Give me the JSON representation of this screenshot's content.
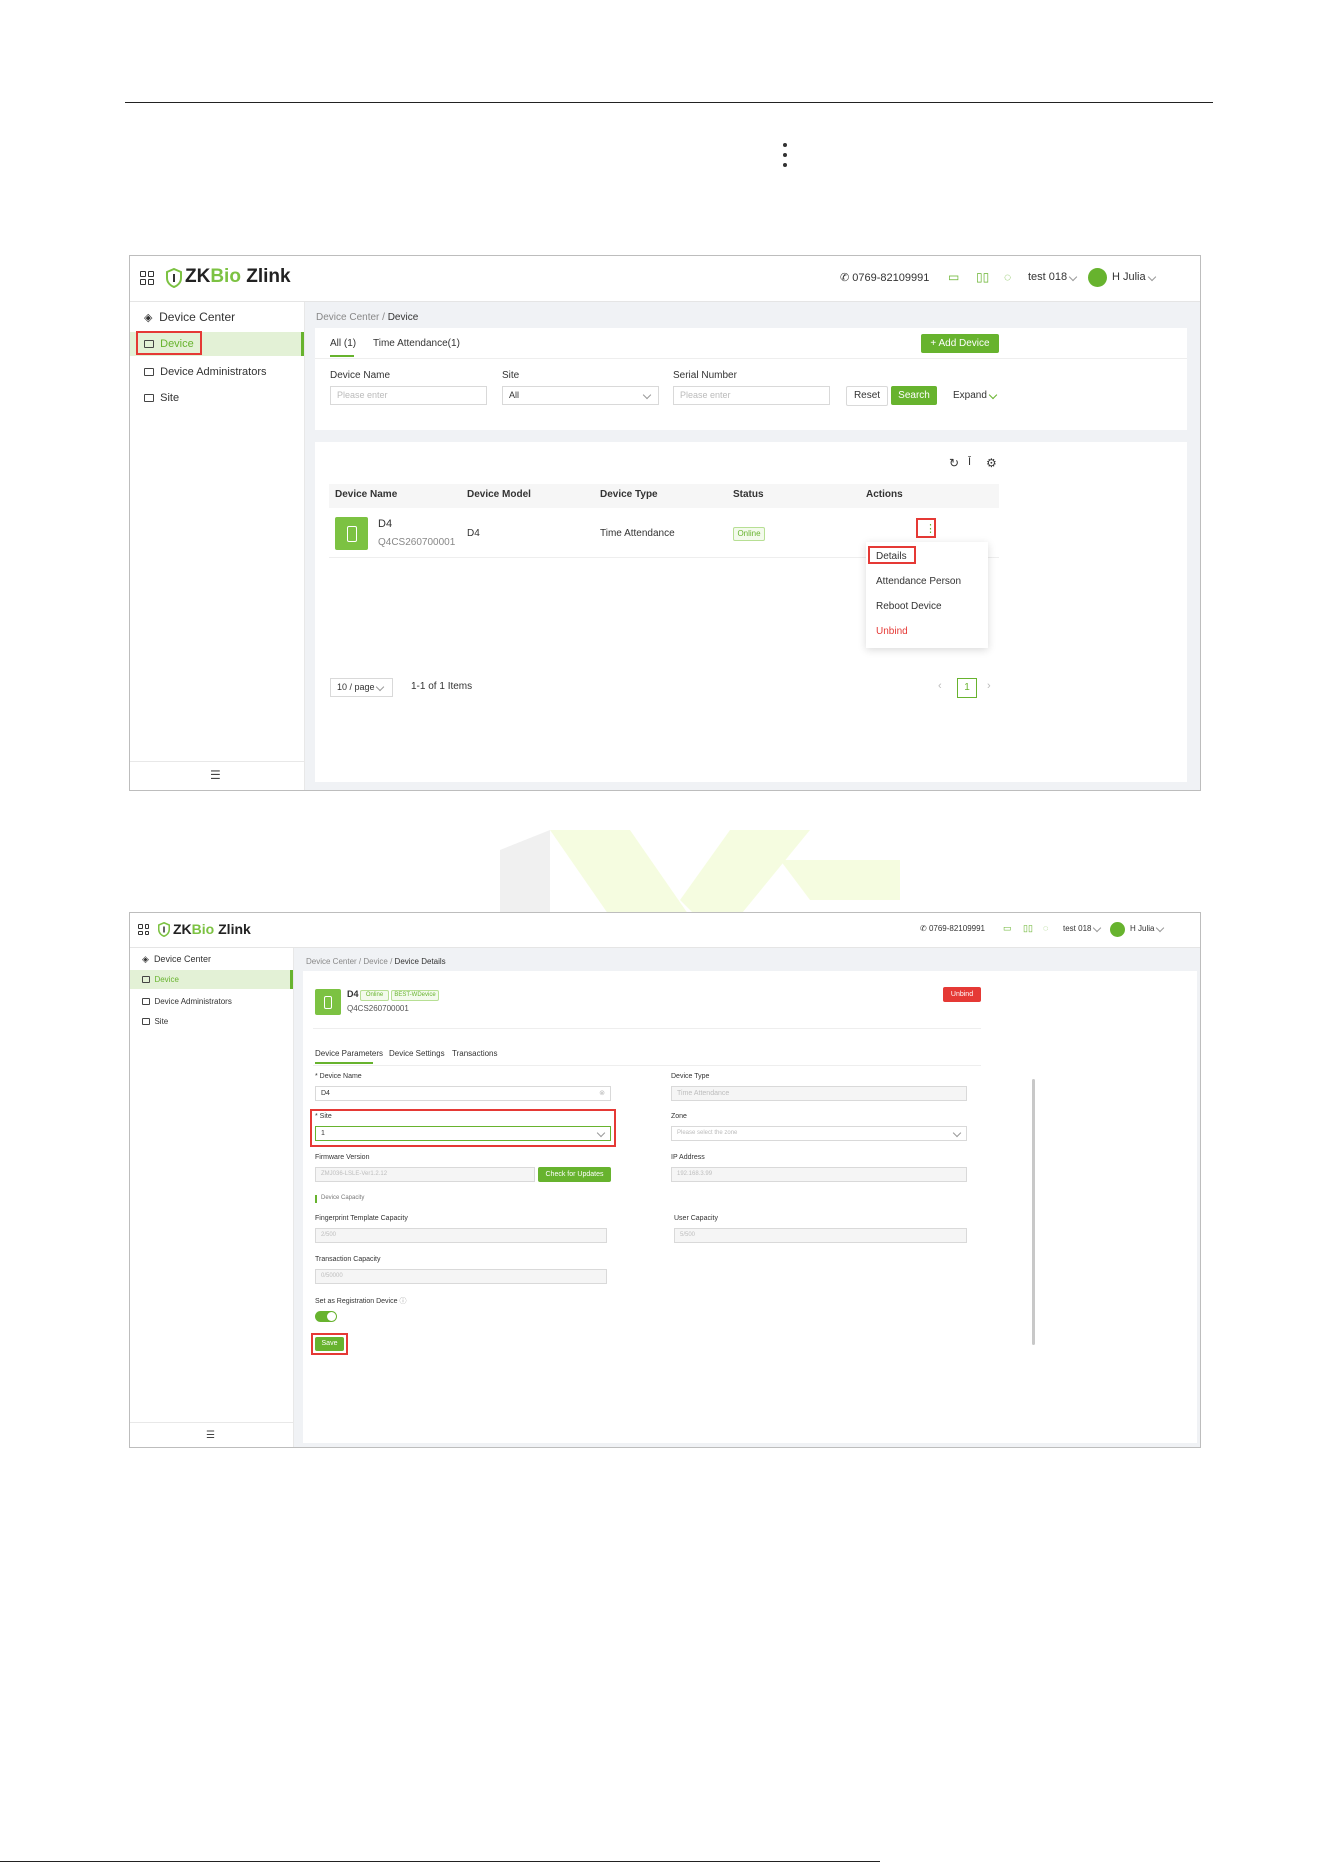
{
  "shot1": {
    "brand": {
      "zk": "ZK",
      "bio": "Bio",
      "zlink": "Zlink"
    },
    "header": {
      "phone": "0769-82109991",
      "org": "test 018",
      "user": "H Julia"
    },
    "sidebar": {
      "title": "Device Center",
      "items": [
        "Device",
        "Device Administrators",
        "Site"
      ]
    },
    "breadcrumb": {
      "parent": "Device Center",
      "sep": "/",
      "current": "Device"
    },
    "tabs": [
      "All (1)",
      "Time Attendance(1)"
    ],
    "add_button": "+ Add Device",
    "filters": {
      "device_name": {
        "label": "Device Name",
        "placeholder": "Please enter"
      },
      "site": {
        "label": "Site",
        "value": "All"
      },
      "serial": {
        "label": "Serial Number",
        "placeholder": "Please enter"
      },
      "reset": "Reset",
      "search": "Search",
      "expand": "Expand"
    },
    "table": {
      "headers": [
        "Device Name",
        "Device Model",
        "Device Type",
        "Status",
        "Actions"
      ],
      "row": {
        "name": "D4",
        "serial": "Q4CS260700001",
        "model": "D4",
        "type": "Time Attendance",
        "status": "Online"
      }
    },
    "menu": [
      "Details",
      "Attendance Person",
      "Reboot Device",
      "Unbind"
    ],
    "pagination": {
      "page_size": "10 / page",
      "summary": "1-1 of 1 Items",
      "page": "1"
    }
  },
  "shot2": {
    "brand": {
      "zk": "ZK",
      "bio": "Bio",
      "zlink": "Zlink"
    },
    "header": {
      "phone": "0769-82109991",
      "org": "test 018",
      "user": "H Julia"
    },
    "sidebar": {
      "title": "Device Center",
      "items": [
        "Device",
        "Device Administrators",
        "Site"
      ]
    },
    "breadcrumb": {
      "a": "Device Center",
      "b": "Device",
      "c": "Device Details",
      "sep": "/"
    },
    "device": {
      "name": "D4",
      "status": "Online",
      "type_tag": "BEST-WDevice",
      "serial": "Q4CS260700001",
      "unbind": "Unbind"
    },
    "tabs": [
      "Device Parameters",
      "Device Settings",
      "Transactions"
    ],
    "form": {
      "device_name": {
        "label": "* Device Name",
        "value": "D4"
      },
      "device_type": {
        "label": "Device Type",
        "value": "Time Attendance"
      },
      "site": {
        "label": "* Site",
        "value": "1"
      },
      "zone": {
        "label": "Zone",
        "placeholder": "Please select the zone"
      },
      "firmware": {
        "label": "Firmware Version",
        "value": "ZMJ036-LSLE-Ver1.2.12",
        "button": "Check for Updates"
      },
      "ip": {
        "label": "IP Address",
        "value": "192.168.3.99"
      },
      "capacity_title": "Device Capacity",
      "fp": {
        "label": "Fingerprint Template Capacity",
        "value": "2/500"
      },
      "user_cap": {
        "label": "User Capacity",
        "value": "5/500"
      },
      "trans": {
        "label": "Transaction Capacity",
        "value": "0/50000"
      },
      "reg": {
        "label": "Set as Registration Device",
        "enabled": true
      },
      "save": "Save"
    }
  },
  "colors": {
    "accent": "#67b32e",
    "danger": "#e53935"
  }
}
